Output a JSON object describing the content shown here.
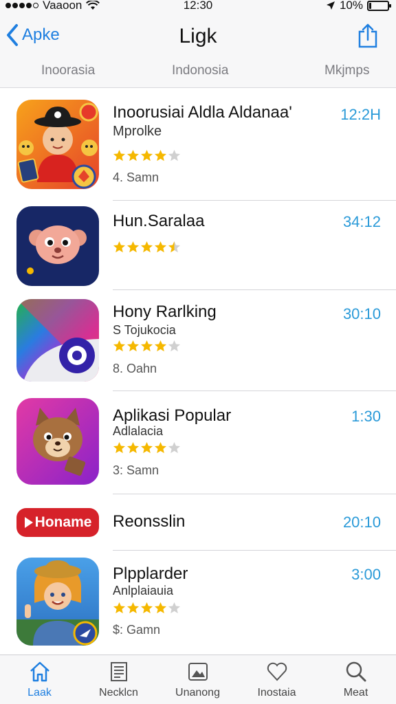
{
  "status_bar": {
    "carrier": "Vaaoon",
    "time": "12:30",
    "battery": "10%",
    "battery_fraction": 0.1,
    "signal_dots": 4
  },
  "nav": {
    "back_label": "Apke",
    "title": "Ligk"
  },
  "subtabs": [
    "Inoorasia",
    "Indonosia",
    "Mkjmps"
  ],
  "apps": [
    {
      "name": "Inoorusiai Aldla Aldanaa'",
      "subtitle": "Mprolke",
      "rating": 4,
      "meta": "4. Samn",
      "time": "12:2H",
      "icon": "cartoon-boy-icon"
    },
    {
      "name": "Hun.Saralaa",
      "subtitle": "",
      "rating": 4.5,
      "meta": "",
      "time": "34:12",
      "icon": "cartoon-face-icon"
    },
    {
      "name": "Hony Rarlking",
      "subtitle": "S Tojukocia",
      "rating": 4,
      "meta": "8. Oahn",
      "time": "30:10",
      "icon": "eye-play-icon"
    },
    {
      "name": "Aplikasi Popular",
      "subtitle": "Adlalacia",
      "rating": 4,
      "meta": "3: Samn",
      "time": "1:30",
      "icon": "cartoon-cat-icon"
    },
    {
      "name": "Reonsslin",
      "subtitle": "",
      "rating": null,
      "meta": "",
      "time": "20:10",
      "icon": "banner-icon",
      "banner_text": "Honame"
    },
    {
      "name": "Plpplarder",
      "subtitle": "Anlplaiauia",
      "rating": 4,
      "meta": "$: Gamn",
      "time": "3:00",
      "icon": "cartoon-girl-icon"
    }
  ],
  "tabbar": [
    {
      "label": "Laak",
      "icon": "home-icon",
      "active": true
    },
    {
      "label": "Necklcn",
      "icon": "document-icon",
      "active": false
    },
    {
      "label": "Unanong",
      "icon": "photo-icon",
      "active": false
    },
    {
      "label": "Inostaia",
      "icon": "heart-icon",
      "active": false
    },
    {
      "label": "Meat",
      "icon": "search-icon",
      "active": false
    }
  ],
  "colors": {
    "accent": "#1f7fe0",
    "time": "#2a9ad8",
    "star": "#f5b800",
    "star_empty": "#d0d0d0"
  }
}
